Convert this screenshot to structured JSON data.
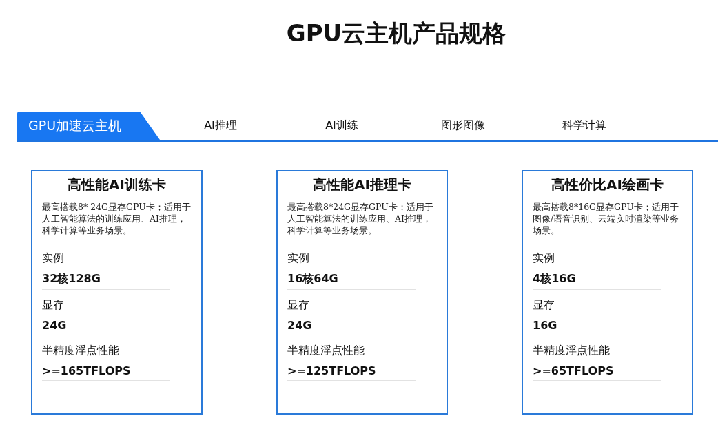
{
  "page_title": "GPU云主机产品规格",
  "tabs": [
    {
      "label": "GPU加速云主机",
      "selected": true
    },
    {
      "label": "AI推理",
      "selected": false
    },
    {
      "label": "AI训练",
      "selected": false
    },
    {
      "label": "图形图像",
      "selected": false
    },
    {
      "label": "科学计算",
      "selected": false
    }
  ],
  "cards": [
    {
      "title": "高性能AI训练卡",
      "description": "最高搭载8* 24G显存GPU卡；适用于人工智能算法的训练应用、AI推理，科学计算等业务场景。",
      "specs": [
        {
          "label": "实例",
          "value": "32核128G"
        },
        {
          "label": "显存",
          "value": "24G"
        },
        {
          "label": "半精度浮点性能",
          "value": ">=165TFLOPS"
        }
      ]
    },
    {
      "title": "高性能AI推理卡",
      "description": "最高搭载8*24G显存GPU卡；适用于人工智能算法的训练应用、AI推理，科学计算等业务场景。",
      "specs": [
        {
          "label": "实例",
          "value": "16核64G"
        },
        {
          "label": "显存",
          "value": "24G"
        },
        {
          "label": "半精度浮点性能",
          "value": ">=125TFLOPS"
        }
      ]
    },
    {
      "title": "高性价比AI绘画卡",
      "description": "最高搭载8*16G显存GPU卡；适用于图像/语音识别、云端实时渲染等业务场景。",
      "specs": [
        {
          "label": "实例",
          "value": "4核16G"
        },
        {
          "label": "显存",
          "value": "16G"
        },
        {
          "label": "半精度浮点性能",
          "value": ">=65TFLOPS"
        }
      ]
    }
  ]
}
